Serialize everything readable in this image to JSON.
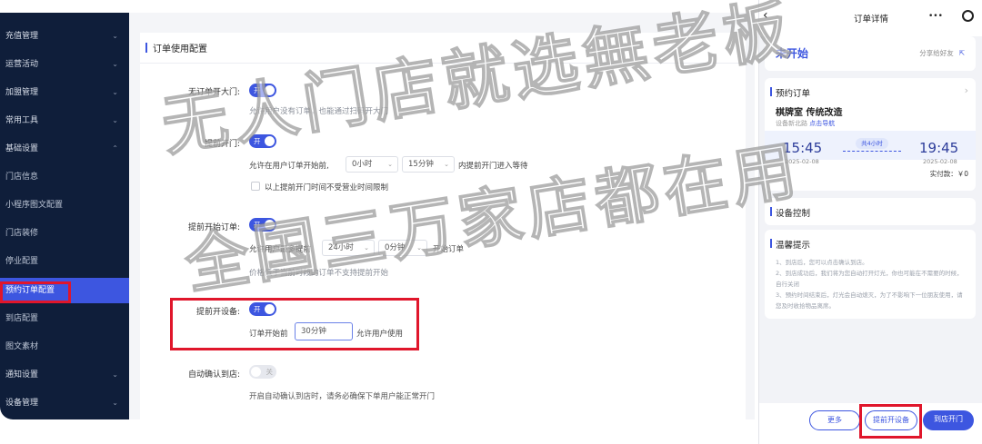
{
  "sidebar": {
    "items": [
      {
        "label": "充值管理",
        "chevron": "⌄"
      },
      {
        "label": "运营活动",
        "chevron": "⌄"
      },
      {
        "label": "加盟管理",
        "chevron": "⌄"
      },
      {
        "label": "常用工具",
        "chevron": "⌄"
      },
      {
        "label": "基础设置",
        "chevron": "⌃"
      },
      {
        "label": "门店信息"
      },
      {
        "label": "小程序图文配置"
      },
      {
        "label": "门店装修"
      },
      {
        "label": "停业配置"
      },
      {
        "label": "预约订单配置"
      },
      {
        "label": "到店配置"
      },
      {
        "label": "图文素材"
      },
      {
        "label": "通知设置",
        "chevron": "⌄"
      },
      {
        "label": "设备管理",
        "chevron": "⌄"
      }
    ]
  },
  "main": {
    "title": "订单使用配置",
    "settings": {
      "no_order_open": {
        "label": "无订单开大门:",
        "toggle": "开",
        "help": "允许用户没有订单，也能通过扫码开大门"
      },
      "early_open": {
        "label": "提前开门:",
        "toggle": "开",
        "pre": "允许在用户订单开始前,",
        "hours": "0小时",
        "minutes": "15分钟",
        "post": "内提前开门进入等待",
        "checkbox_label": "以上提前开门时间不受营业时间限制"
      },
      "early_start": {
        "label": "提前开始订单:",
        "toggle": "开",
        "pre": "允许用户最多提前",
        "hours": "24小时",
        "minutes": "0分钟",
        "post": "开始订单",
        "help": "价格低于当前时段的订单不支持提前开始"
      },
      "early_device": {
        "label": "提前开设备:",
        "toggle": "开",
        "pre": "订单开始前",
        "value": "30分钟",
        "post": "允许用户使用"
      },
      "auto_confirm": {
        "label": "自动确认到店:",
        "toggle": "关",
        "help": "开启自动确认到店时，请务必确保下单用户能正常开门"
      }
    }
  },
  "phone": {
    "title": "订单详情",
    "menu_icon": "•••",
    "status": "未开始",
    "share": "分享给好友",
    "booking": {
      "title": "预约订单",
      "room": "棋牌室 传统改造",
      "addr": "设备新北路",
      "nav": "点击导航",
      "start_time": "15:45",
      "start_date": "2025-02-08",
      "duration": "共4小时",
      "end_time": "19:45",
      "end_date": "2025-02-08",
      "paid": "实付款：￥0"
    },
    "device_title": "设备控制",
    "tips": {
      "title": "温馨提示",
      "lines": [
        "1、到店后，您可以点击确认到店。",
        "2、到店成功后，我们将为您自动打开灯光，你也可能在不需要的时候，自行关闭",
        "3、预约时间结束后，灯光会自动熄灭，为了不影响下一位朋友使用，请您及时收拾物品离席。"
      ]
    },
    "buttons": {
      "more": "更多",
      "early_device": "提前开设备",
      "open_door": "到店开门"
    }
  },
  "watermark": {
    "line1": "无人门店就选無老板",
    "line2": "全国三万家店都在用"
  }
}
